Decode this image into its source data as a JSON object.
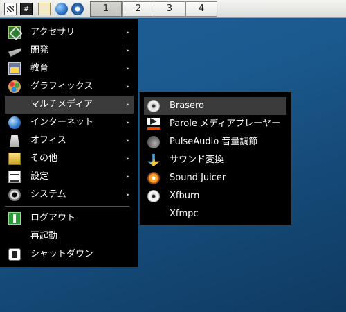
{
  "panel": {
    "launchers": [
      {
        "icon": "applications-menu-icon"
      },
      {
        "icon": "terminal-icon",
        "text": "#"
      },
      {
        "icon": "file-manager-icon"
      },
      {
        "icon": "web-browser-icon"
      },
      {
        "icon": "app-finder-icon"
      }
    ],
    "workspaces": [
      "1",
      "2",
      "3",
      "4"
    ],
    "active_workspace": "1"
  },
  "main_menu": {
    "items": [
      {
        "label": "アクセサリ",
        "icon": "accessories-icon",
        "submenu": true
      },
      {
        "label": "開発",
        "icon": "development-icon",
        "submenu": true
      },
      {
        "label": "教育",
        "icon": "education-icon",
        "submenu": true
      },
      {
        "label": "グラフィックス",
        "icon": "graphics-icon",
        "submenu": true
      },
      {
        "label": "マルチメディア",
        "icon": "multimedia-icon",
        "submenu": true,
        "selected": true
      },
      {
        "label": "インターネット",
        "icon": "internet-icon",
        "submenu": true
      },
      {
        "label": "オフィス",
        "icon": "office-icon",
        "submenu": true
      },
      {
        "label": "その他",
        "icon": "other-icon",
        "submenu": true
      },
      {
        "label": "設定",
        "icon": "settings-icon",
        "submenu": true
      },
      {
        "label": "システム",
        "icon": "system-icon",
        "submenu": true
      }
    ],
    "session": [
      {
        "label": "ログアウト",
        "icon": "logout-icon"
      },
      {
        "label": "再起動",
        "icon": ""
      },
      {
        "label": "シャットダウン",
        "icon": "shutdown-icon"
      }
    ],
    "submenu_arrow": "▸"
  },
  "multimedia_menu": {
    "items": [
      {
        "label": "Brasero",
        "icon": "disc-burner-icon",
        "highlighted": true
      },
      {
        "label": "Parole メディアプレーヤー",
        "icon": "media-player-icon"
      },
      {
        "label": "PulseAudio 音量調節",
        "icon": "volume-control-icon"
      },
      {
        "label": "サウンド変換",
        "icon": "sound-converter-icon"
      },
      {
        "label": "Sound Juicer",
        "icon": "cd-ripper-icon"
      },
      {
        "label": "Xfburn",
        "icon": "xfburn-disc-icon"
      },
      {
        "label": "Xfmpc",
        "icon": ""
      }
    ]
  },
  "colors": {
    "menu_background": "#000000",
    "selection": "#3b3b3b",
    "desktop": "#1b5a8f"
  }
}
